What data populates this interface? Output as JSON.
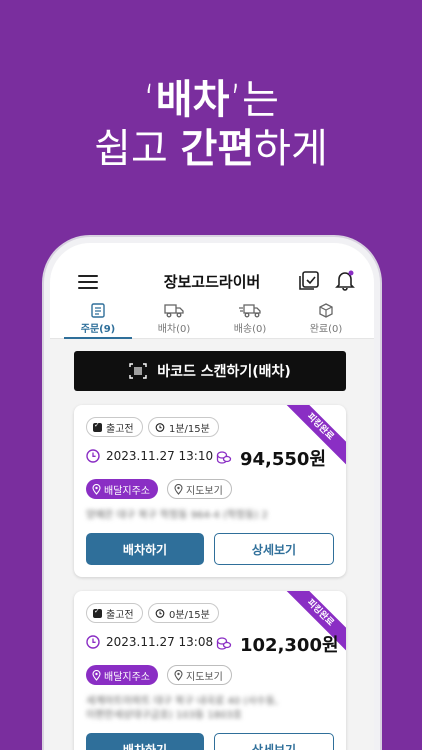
{
  "headline": {
    "line1_quote_open": "‘",
    "line1_strong": "배차",
    "line1_quote_close": "’",
    "line1_rest": "는",
    "line2_a": "쉽고 ",
    "line2_strong": "간편",
    "line2_b": "하게"
  },
  "app": {
    "title": "장보고드라이버"
  },
  "tabs": [
    {
      "label": "주문(9)",
      "icon": "document-icon",
      "active": true
    },
    {
      "label": "배차(0)",
      "icon": "truck-icon",
      "active": false
    },
    {
      "label": "배송(0)",
      "icon": "delivery-truck-icon",
      "active": false
    },
    {
      "label": "완료(0)",
      "icon": "box-icon",
      "active": false
    }
  ],
  "scan_button": {
    "label": "바코드 스캔하기(배차)"
  },
  "orders": [
    {
      "ribbon": "피킹완료",
      "status": "출고전",
      "timer": "1분/15분",
      "datetime": "2023.11.27 13:10",
      "amount": "94,550원",
      "address_button": "배달지주소",
      "map_button": "지도보기",
      "address_line1": "양예은 대구 북구 학정동 964-4 (학정동) 2",
      "address_line2": "",
      "dispatch_button": "배차하기",
      "detail_button": "상세보기"
    },
    {
      "ribbon": "피킹완료",
      "status": "출고전",
      "timer": "0분/15분",
      "datetime": "2023.11.27 13:08",
      "amount": "102,300원",
      "address_button": "배달지주소",
      "map_button": "지도보기",
      "address_line1": "세계마트아파트 대구 북구 내곡로 40 (사수동,",
      "address_line2": "이편한세상대구금호) 103동 1803호",
      "dispatch_button": "배차하기",
      "detail_button": "상세보기"
    }
  ],
  "colors": {
    "background": "#7a2e9e",
    "accent": "#8a2ec4",
    "primary": "#2f6f9a"
  }
}
